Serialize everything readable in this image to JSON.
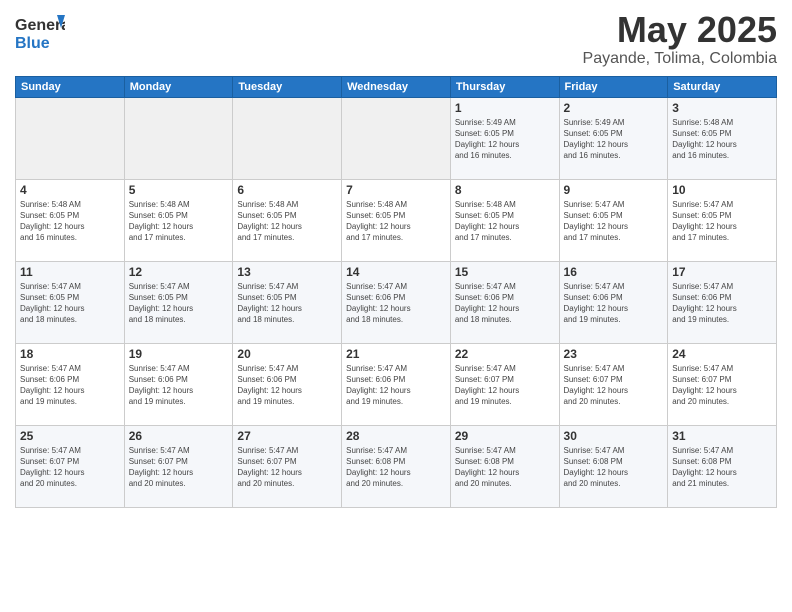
{
  "logo": {
    "line1": "General",
    "line2": "Blue"
  },
  "title": "May 2025",
  "subtitle": "Payande, Tolima, Colombia",
  "weekdays": [
    "Sunday",
    "Monday",
    "Tuesday",
    "Wednesday",
    "Thursday",
    "Friday",
    "Saturday"
  ],
  "weeks": [
    [
      {
        "day": "",
        "info": ""
      },
      {
        "day": "",
        "info": ""
      },
      {
        "day": "",
        "info": ""
      },
      {
        "day": "",
        "info": ""
      },
      {
        "day": "1",
        "info": "Sunrise: 5:49 AM\nSunset: 6:05 PM\nDaylight: 12 hours\nand 16 minutes."
      },
      {
        "day": "2",
        "info": "Sunrise: 5:49 AM\nSunset: 6:05 PM\nDaylight: 12 hours\nand 16 minutes."
      },
      {
        "day": "3",
        "info": "Sunrise: 5:48 AM\nSunset: 6:05 PM\nDaylight: 12 hours\nand 16 minutes."
      }
    ],
    [
      {
        "day": "4",
        "info": "Sunrise: 5:48 AM\nSunset: 6:05 PM\nDaylight: 12 hours\nand 16 minutes."
      },
      {
        "day": "5",
        "info": "Sunrise: 5:48 AM\nSunset: 6:05 PM\nDaylight: 12 hours\nand 17 minutes."
      },
      {
        "day": "6",
        "info": "Sunrise: 5:48 AM\nSunset: 6:05 PM\nDaylight: 12 hours\nand 17 minutes."
      },
      {
        "day": "7",
        "info": "Sunrise: 5:48 AM\nSunset: 6:05 PM\nDaylight: 12 hours\nand 17 minutes."
      },
      {
        "day": "8",
        "info": "Sunrise: 5:48 AM\nSunset: 6:05 PM\nDaylight: 12 hours\nand 17 minutes."
      },
      {
        "day": "9",
        "info": "Sunrise: 5:47 AM\nSunset: 6:05 PM\nDaylight: 12 hours\nand 17 minutes."
      },
      {
        "day": "10",
        "info": "Sunrise: 5:47 AM\nSunset: 6:05 PM\nDaylight: 12 hours\nand 17 minutes."
      }
    ],
    [
      {
        "day": "11",
        "info": "Sunrise: 5:47 AM\nSunset: 6:05 PM\nDaylight: 12 hours\nand 18 minutes."
      },
      {
        "day": "12",
        "info": "Sunrise: 5:47 AM\nSunset: 6:05 PM\nDaylight: 12 hours\nand 18 minutes."
      },
      {
        "day": "13",
        "info": "Sunrise: 5:47 AM\nSunset: 6:05 PM\nDaylight: 12 hours\nand 18 minutes."
      },
      {
        "day": "14",
        "info": "Sunrise: 5:47 AM\nSunset: 6:06 PM\nDaylight: 12 hours\nand 18 minutes."
      },
      {
        "day": "15",
        "info": "Sunrise: 5:47 AM\nSunset: 6:06 PM\nDaylight: 12 hours\nand 18 minutes."
      },
      {
        "day": "16",
        "info": "Sunrise: 5:47 AM\nSunset: 6:06 PM\nDaylight: 12 hours\nand 19 minutes."
      },
      {
        "day": "17",
        "info": "Sunrise: 5:47 AM\nSunset: 6:06 PM\nDaylight: 12 hours\nand 19 minutes."
      }
    ],
    [
      {
        "day": "18",
        "info": "Sunrise: 5:47 AM\nSunset: 6:06 PM\nDaylight: 12 hours\nand 19 minutes."
      },
      {
        "day": "19",
        "info": "Sunrise: 5:47 AM\nSunset: 6:06 PM\nDaylight: 12 hours\nand 19 minutes."
      },
      {
        "day": "20",
        "info": "Sunrise: 5:47 AM\nSunset: 6:06 PM\nDaylight: 12 hours\nand 19 minutes."
      },
      {
        "day": "21",
        "info": "Sunrise: 5:47 AM\nSunset: 6:06 PM\nDaylight: 12 hours\nand 19 minutes."
      },
      {
        "day": "22",
        "info": "Sunrise: 5:47 AM\nSunset: 6:07 PM\nDaylight: 12 hours\nand 19 minutes."
      },
      {
        "day": "23",
        "info": "Sunrise: 5:47 AM\nSunset: 6:07 PM\nDaylight: 12 hours\nand 20 minutes."
      },
      {
        "day": "24",
        "info": "Sunrise: 5:47 AM\nSunset: 6:07 PM\nDaylight: 12 hours\nand 20 minutes."
      }
    ],
    [
      {
        "day": "25",
        "info": "Sunrise: 5:47 AM\nSunset: 6:07 PM\nDaylight: 12 hours\nand 20 minutes."
      },
      {
        "day": "26",
        "info": "Sunrise: 5:47 AM\nSunset: 6:07 PM\nDaylight: 12 hours\nand 20 minutes."
      },
      {
        "day": "27",
        "info": "Sunrise: 5:47 AM\nSunset: 6:07 PM\nDaylight: 12 hours\nand 20 minutes."
      },
      {
        "day": "28",
        "info": "Sunrise: 5:47 AM\nSunset: 6:08 PM\nDaylight: 12 hours\nand 20 minutes."
      },
      {
        "day": "29",
        "info": "Sunrise: 5:47 AM\nSunset: 6:08 PM\nDaylight: 12 hours\nand 20 minutes."
      },
      {
        "day": "30",
        "info": "Sunrise: 5:47 AM\nSunset: 6:08 PM\nDaylight: 12 hours\nand 20 minutes."
      },
      {
        "day": "31",
        "info": "Sunrise: 5:47 AM\nSunset: 6:08 PM\nDaylight: 12 hours\nand 21 minutes."
      }
    ]
  ]
}
